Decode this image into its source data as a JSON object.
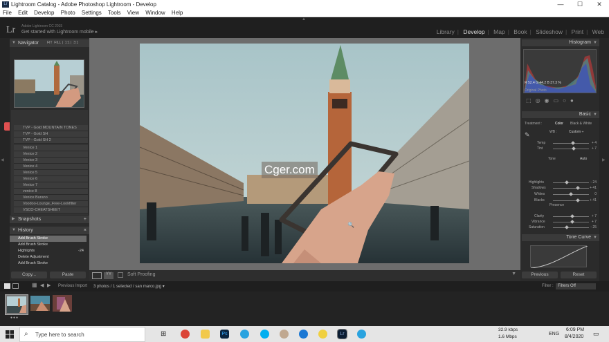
{
  "window": {
    "title": "Lightroom Catalog - Adobe Photoshop Lightroom - Develop",
    "min": "—",
    "max": "☐",
    "close": "✕"
  },
  "menu": [
    "File",
    "Edit",
    "Develop",
    "Photo",
    "Settings",
    "Tools",
    "View",
    "Window",
    "Help"
  ],
  "identity": {
    "logo": "Lr",
    "sub": "Adobe Lightroom CC 2015",
    "main": "Get started with Lightroom mobile ▸"
  },
  "modules": [
    "Library",
    "Develop",
    "Map",
    "Book",
    "Slideshow",
    "Print",
    "Web"
  ],
  "navigator": {
    "label": "Navigator",
    "zoom": [
      "FIT",
      "FILL",
      "1:1",
      "3:1"
    ]
  },
  "presets": [
    "TVP - Gold MOUNTAIN TONES",
    "TVP - Gold SH",
    "TVP - Gold SH 2",
    "Venice 1",
    "Venice 2",
    "Venice 3",
    "Venice 4",
    "Venice 5",
    "Venice 6",
    "Venice 7",
    "venice 8",
    "Venice Burano",
    "Voodoo-Lounge_Free-Lookfilter",
    "VSCO-CHEATSHEET"
  ],
  "snapshots": {
    "label": "Snapshots",
    "add": "+"
  },
  "history": {
    "label": "History",
    "clear": "×",
    "items": [
      {
        "label": "Add Brush Stroke",
        "value": "",
        "selected": true
      },
      {
        "label": "Add Brush Stroke",
        "value": "",
        "selected": false
      },
      {
        "label": "Highlights",
        "value": "-24",
        "selected": false
      },
      {
        "label": "Delete Adjustment",
        "value": "",
        "selected": false
      },
      {
        "label": "Add Brush Stroke",
        "value": "",
        "selected": false
      }
    ]
  },
  "left_buttons": {
    "copy": "Copy...",
    "paste": "Paste"
  },
  "toolbar": {
    "soft_proofing": "Soft Proofing"
  },
  "watermark": "Cger.com",
  "histogram": {
    "label": "Histogram",
    "readout": "R  52.4   G  44.2   B  37.3  %",
    "original": "Original Photo"
  },
  "basic": {
    "label": "Basic",
    "treatment_label": "Treatment :",
    "color": "Color",
    "bw": "Black & White",
    "wb_label": "WB :",
    "wb_value": "Custom ÷",
    "tone": "Tone",
    "auto": "Auto"
  },
  "sliders": [
    {
      "label": "Temp",
      "value": "+ 4",
      "pos": 0.56
    },
    {
      "label": "Tint",
      "value": "+ 7",
      "pos": 0.58
    },
    {
      "label": "Highlights",
      "value": "- 24",
      "pos": 0.38
    },
    {
      "label": "Shadows",
      "value": "+ 41",
      "pos": 0.7
    },
    {
      "label": "Whites",
      "value": "0",
      "pos": 0.5
    },
    {
      "label": "Blacks",
      "value": "+ 41",
      "pos": 0.7
    }
  ],
  "presence": {
    "label": "Presence"
  },
  "presence_sliders": [
    {
      "label": "Clarity",
      "value": "+ 7",
      "pos": 0.54
    },
    {
      "label": "Vibrance",
      "value": "+ 7",
      "pos": 0.54
    },
    {
      "label": "Saturation",
      "value": "- 25",
      "pos": 0.38
    }
  ],
  "tone_curve": {
    "label": "Tone Curve"
  },
  "right_buttons": {
    "previous": "Previous",
    "reset": "Reset"
  },
  "filmbar": {
    "source": "Previous Import",
    "info": "3 photos / 1 selected / san marco.jpg ▾",
    "filter_label": "Filter :",
    "filter_value": "Filters Off"
  },
  "taskbar": {
    "search": "Type here to search",
    "net_up": "32.9 kbps",
    "net_down": "1.6 Mbps",
    "lang": "ENG",
    "time": "6:09 PM",
    "date": "8/4/2020"
  }
}
